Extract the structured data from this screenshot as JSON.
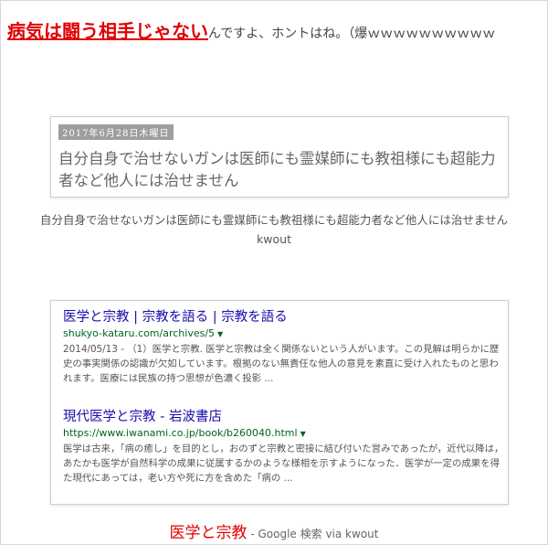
{
  "headline": {
    "link_text": "病気は闘う相手じゃない",
    "rest_text": "んですよ、ホントはね。（爆ｗｗｗｗｗｗｗｗｗｗ"
  },
  "blog_card": {
    "date": "2017年6月28日木曜日",
    "title": "自分自身で治せないガンは医師にも霊媒師にも教祖様にも超能力者など他人には治せません"
  },
  "blog_caption": {
    "title": "自分自身で治せないガンは医師にも霊媒師にも教祖様にも超能力者など他人には治せません",
    "source": "kwout"
  },
  "search_card": {
    "results": [
      {
        "title": "医学と宗教 | 宗教を語る | 宗教を語る",
        "url": "shukyo-kataru.com/archives/5",
        "snippet": "2014/05/13 - （1）医学と宗教. 医学と宗教は全く関係ないという人がいます。この見解は明らかに歴史の事実関係の認識が欠如しています。根拠のない無責任な他人の意見を素直に受け入れたものと思われます。医療には民族の持つ思想が色濃く投影 ..."
      },
      {
        "title": "現代医学と宗教 - 岩波書店",
        "url": "https://www.iwanami.co.jp/book/b260040.html",
        "snippet": "医学は古来，「病の癒し」を目的とし，おのずと宗教と密接に結び付いた営みであったが，近代以降は，あたかも医学が自然科学の成果に従属するかのような様相を示すようになった．医学が一定の成果を得た現代にあっては，老い方や死に方を含めた「病の ..."
      }
    ]
  },
  "search_caption": {
    "query": "医学と宗教",
    "separator": " - ",
    "engine": "Google 検索",
    "via": " via ",
    "source": "kwout"
  },
  "colors": {
    "accent_red": "#e00000",
    "link_blue": "#1a0dab",
    "url_green": "#006621"
  }
}
